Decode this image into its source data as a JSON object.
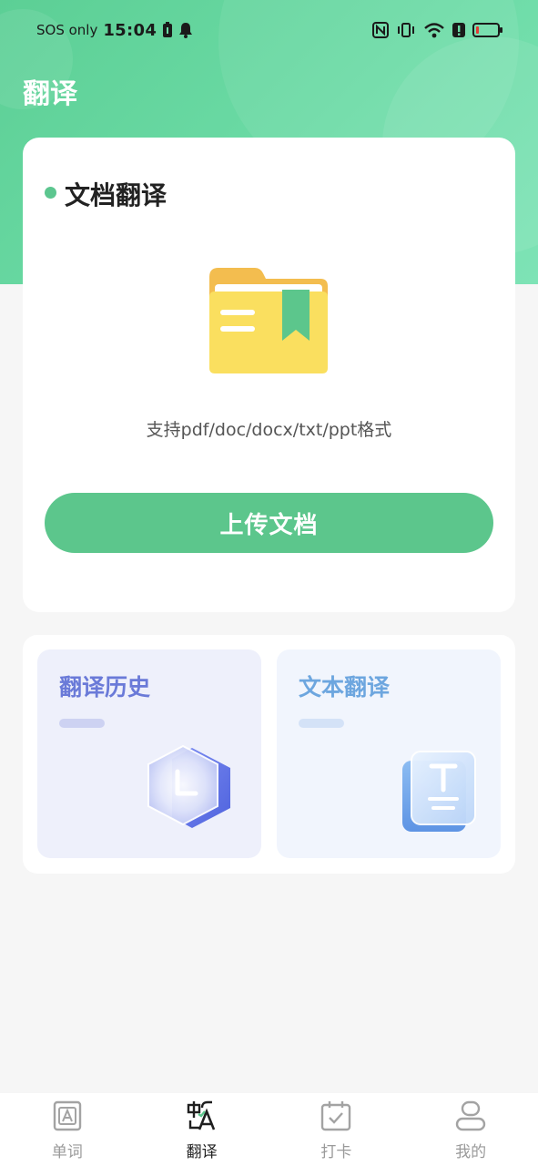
{
  "status_bar": {
    "carrier": "SOS only",
    "time": "15:04"
  },
  "header": {
    "title": "翻译"
  },
  "document_card": {
    "title": "文档翻译",
    "formats": "支持pdf/doc/docx/txt/ppt格式",
    "upload_label": "上传文档",
    "icon": "folder-icon"
  },
  "tools": {
    "history": {
      "label": "翻译历史",
      "icon": "clock-hexagon-icon"
    },
    "text_translate": {
      "label": "文本翻译",
      "icon": "text-doc-icon"
    }
  },
  "tab_bar": {
    "items": [
      {
        "label": "单词",
        "icon": "word-book-icon",
        "active": false
      },
      {
        "label": "翻译",
        "icon": "translate-icon",
        "active": true
      },
      {
        "label": "打卡",
        "icon": "calendar-check-icon",
        "active": false
      },
      {
        "label": "我的",
        "icon": "profile-icon",
        "active": false
      }
    ]
  },
  "colors": {
    "brand_green": "#5cc68c",
    "history_accent": "#6a7ad8",
    "text_accent": "#6da6df"
  }
}
